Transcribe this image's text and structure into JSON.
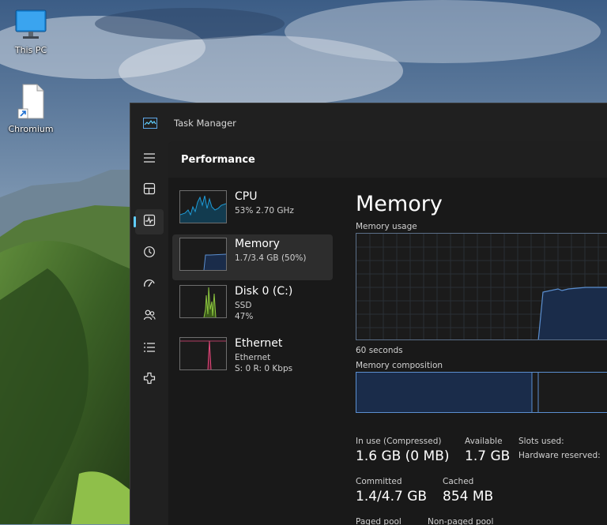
{
  "desktop": {
    "icons": [
      {
        "label": "This PC",
        "icon": "monitor-icon"
      },
      {
        "label": "Chromium",
        "icon": "file-shortcut-icon"
      }
    ]
  },
  "window": {
    "title": "Task Manager",
    "section_title": "Performance"
  },
  "rail": {
    "items": [
      "hamburger-menu-icon",
      "processes-icon",
      "performance-icon",
      "app-history-icon",
      "startup-apps-icon",
      "users-icon",
      "details-icon",
      "services-icon"
    ],
    "active_index": 2
  },
  "devices": [
    {
      "name": "CPU",
      "line1": "53% 2.70 GHz",
      "line2": "",
      "color": "#1e9bd7",
      "selected": false
    },
    {
      "name": "Memory",
      "line1": "1.7/3.4 GB (50%)",
      "line2": "",
      "color": "#5b8fd0",
      "selected": true
    },
    {
      "name": "Disk 0 (C:)",
      "line1": "SSD",
      "line2": "47%",
      "color": "#8cc63f",
      "selected": false
    },
    {
      "name": "Ethernet",
      "line1": "Ethernet",
      "line2": "S: 0 R: 0 Kbps",
      "color": "#e34a7c",
      "selected": false
    }
  ],
  "memory": {
    "title": "Memory",
    "usage_label": "Memory usage",
    "time_label": "60 seconds",
    "composition_label": "Memory composition",
    "in_use_label": "In use (Compressed)",
    "in_use_value": "1.6 GB (0 MB)",
    "available_label": "Available",
    "available_value": "1.7 GB",
    "slots_label": "Slots used:",
    "hw_reserved_label": "Hardware reserved:",
    "committed_label": "Committed",
    "committed_value": "1.4/4.7 GB",
    "cached_label": "Cached",
    "cached_value": "854 MB",
    "paged_label": "Paged pool",
    "nonpaged_label": "Non-paged pool"
  },
  "colors": {
    "accent": "#60cdff",
    "memory_line": "#5b8fd0",
    "memory_fill": "#1a2c4a"
  }
}
